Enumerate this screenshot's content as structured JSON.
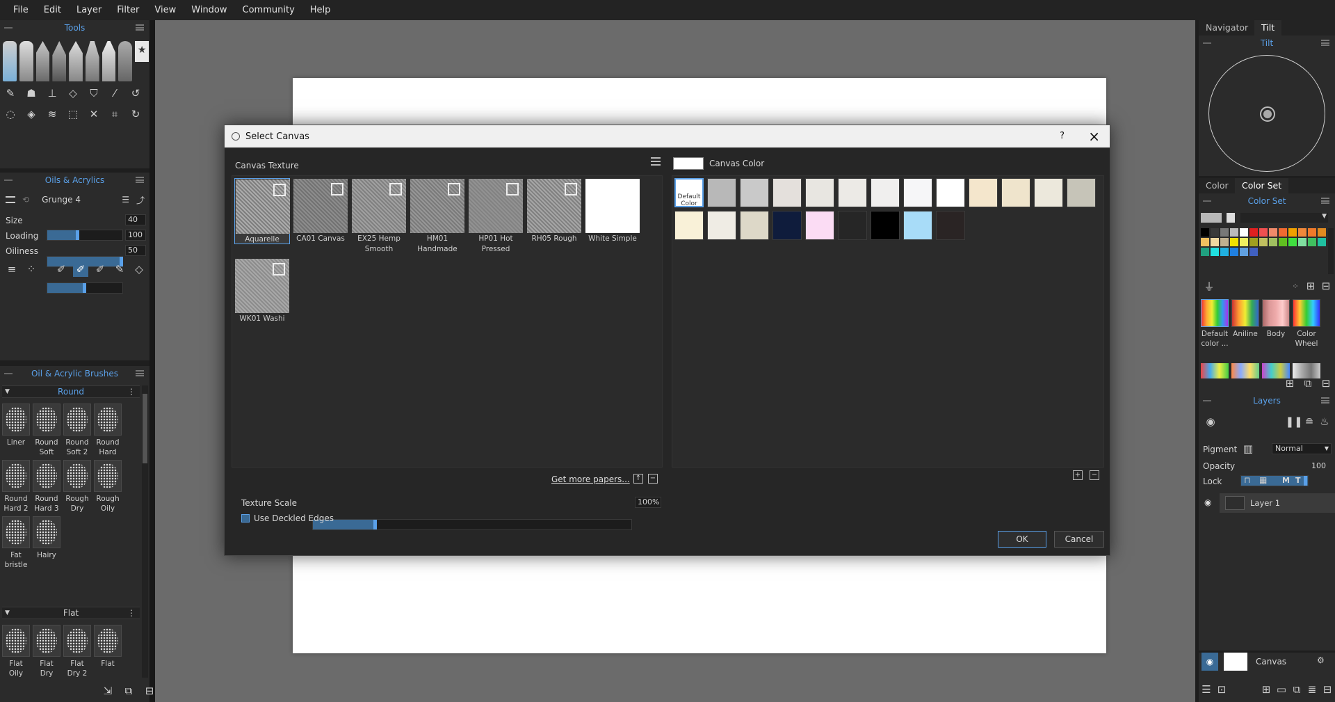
{
  "menu": [
    "File",
    "Edit",
    "Layer",
    "Filter",
    "View",
    "Window",
    "Community",
    "Help"
  ],
  "tools_panel": {
    "title": "Tools"
  },
  "oils_panel": {
    "title": "Oils & Acrylics",
    "preset": "Grunge 4",
    "size_label": "Size",
    "size_value": "40",
    "size": 0.4,
    "loading_label": "Loading",
    "loading_value": "100",
    "loading": 1.0,
    "oiliness_label": "Oiliness",
    "oiliness_value": "50",
    "oiliness": 0.5
  },
  "brushes_panel": {
    "title": "Oil & Acrylic Brushes",
    "group_round": "Round",
    "round_brushes": [
      "Liner",
      "Round Soft",
      "Round Soft 2",
      "Round Hard",
      "Round Hard 2",
      "Round Hard 3",
      "Rough Dry",
      "Rough Oily",
      "Fat bristle",
      "Hairy"
    ],
    "group_flat": "Flat",
    "flat_brushes": [
      "Flat Oily",
      "Flat Dry",
      "Flat Dry 2",
      "Flat"
    ]
  },
  "dialog": {
    "title": "Select Canvas",
    "help": "?",
    "close": "×",
    "texture_label": "Canvas Texture",
    "textures": [
      "Aquarelle",
      "CA01 Canvas",
      "EX25 Hemp Smooth",
      "HM01 Handmade",
      "HP01 Hot Pressed",
      "RH05 Rough",
      "White Simple",
      "WK01 Washi"
    ],
    "color_label": "Canvas Color",
    "default_color_label": "Default Color",
    "swatches_row1": [
      "#ffffff",
      "#b8b8b8",
      "#c9c9c9",
      "#e4e0dc",
      "#e8e6e1",
      "#eceae6",
      "#f0efee",
      "#f6f6f8",
      "#ffffff",
      "#f4e6cc",
      "#efe4cc",
      "#ece8dc",
      "#c6c4b8"
    ],
    "swatches_row2": [
      "#f9f1d8",
      "#efece4",
      "#ddd8c8",
      "#0f1c3c",
      "#fbdcf4",
      "#262626",
      "#000000",
      "#a8dcf8",
      "#2a2424"
    ],
    "get_more": "Get more papers...",
    "scale_label": "Texture Scale",
    "scale_value": "100%",
    "scale": 0.2,
    "deckled": "Use Deckled Edges",
    "ok": "OK",
    "cancel": "Cancel"
  },
  "right": {
    "tabs": [
      "Navigator",
      "Tilt"
    ],
    "tilt_title": "Tilt",
    "color_tabs": [
      "Color",
      "Color Set"
    ],
    "color_set_title": "Color Set",
    "palettes": [
      "Default color ...",
      "Aniline",
      "Body",
      "Color Wheel"
    ],
    "layers_title": "Layers",
    "pigment_label": "Pigment",
    "blend_mode": "Normal",
    "opacity_label": "Opacity",
    "opacity_value": "100",
    "opacity": 1.0,
    "lock_label": "Lock",
    "lock_m": "M",
    "lock_t": "T",
    "layer_name": "Layer 1",
    "canvas_label": "Canvas"
  },
  "palette_colors": [
    "#000000",
    "#3a3a3a",
    "#777777",
    "#bbbbbb",
    "#ffffff",
    "#e02020",
    "#f05050",
    "#f08a6a",
    "#f06a30",
    "#f0a000",
    "#f0883a",
    "#f07a2a",
    "#e08a20",
    "#f0c060",
    "#f0d8a0",
    "#c0b090",
    "#f0e000",
    "#f0f060",
    "#a0a020",
    "#c0c060",
    "#a0c060",
    "#60c020",
    "#40e040",
    "#80e0a0",
    "#40c060",
    "#20c0a0",
    "#20a080",
    "#20e0e0",
    "#20b0e0",
    "#2080e0",
    "#60a0e0",
    "#4060c0"
  ]
}
